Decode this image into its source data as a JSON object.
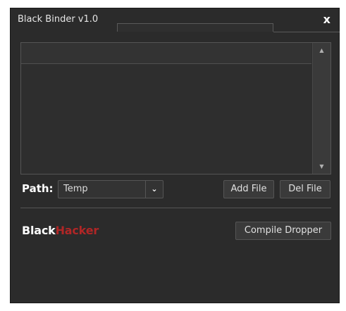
{
  "window": {
    "title": "Black Binder v1.0",
    "close_label": "x"
  },
  "list": {
    "scroll_up": "▲",
    "scroll_down": "▼"
  },
  "path": {
    "label": "Path:",
    "selected": "Temp",
    "chevron": "⌄"
  },
  "buttons": {
    "add_file": "Add File",
    "del_file": "Del File",
    "compile": "Compile Dropper"
  },
  "brand": {
    "part1": "Black",
    "part2": "Hacker"
  },
  "colors": {
    "background": "#2b2b2b",
    "brand_red": "#b02626",
    "text": "#e0e0e0"
  }
}
